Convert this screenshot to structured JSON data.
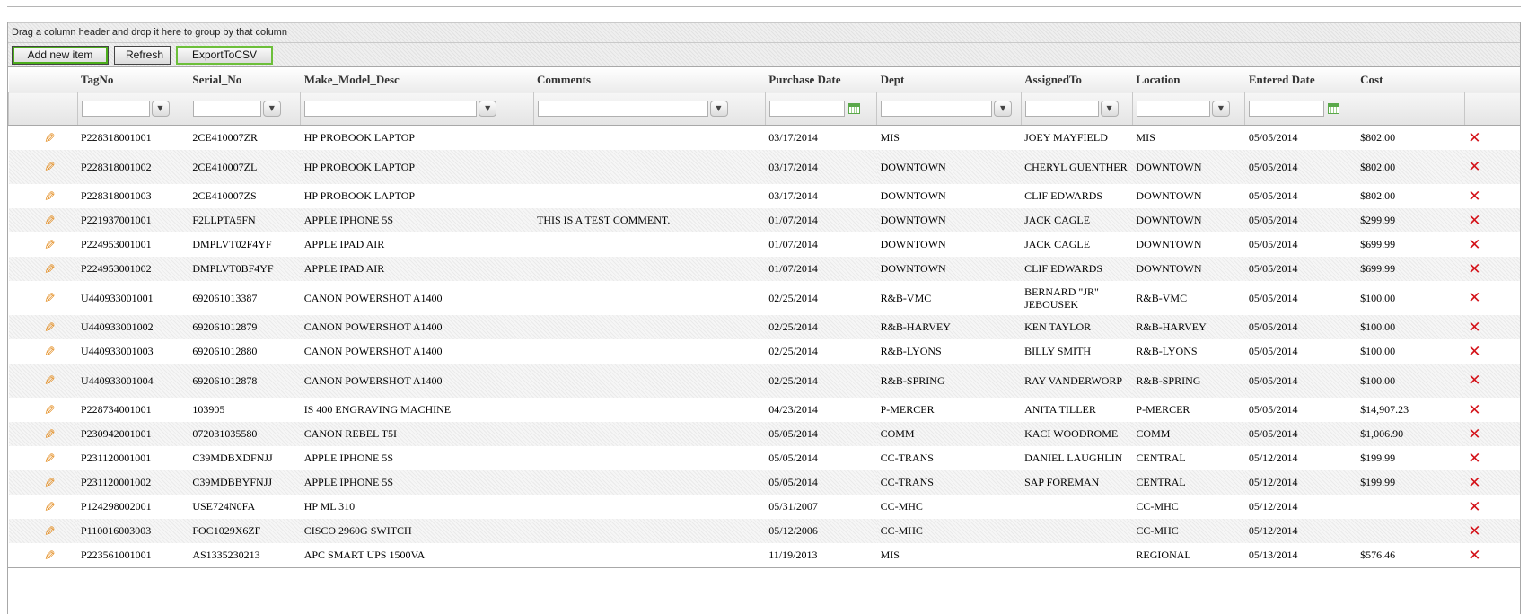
{
  "group_panel": {
    "hint": "Drag a column header and drop it here to group by that column"
  },
  "toolbar": {
    "add_label": "Add new item",
    "refresh_label": "Refresh",
    "export_label": "ExportToCSV"
  },
  "columns": [
    "TagNo",
    "Serial_No",
    "Make_Model_Desc",
    "Comments",
    "Purchase Date",
    "Dept",
    "AssignedTo",
    "Location",
    "Entered Date",
    "Cost"
  ],
  "icons": {
    "edit": "pencil-icon",
    "delete": "close-x-icon",
    "filter": "filter-funnel-icon",
    "calendar": "calendar-icon"
  },
  "colors": {
    "delete": "#d4141b",
    "edit": "#e38a1b",
    "button_outline": "#4cae1c"
  },
  "rows": [
    {
      "tag": "P228318001001",
      "serial": "2CE410007ZR",
      "model": "HP PROBOOK LAPTOP",
      "comments": "",
      "purchase": "03/17/2014",
      "dept": "MIS",
      "assigned": "JOEY MAYFIELD",
      "location": "MIS",
      "entered": "05/05/2014",
      "cost": "$802.00"
    },
    {
      "tag": "P228318001002",
      "serial": "2CE410007ZL",
      "model": "HP PROBOOK LAPTOP",
      "comments": "",
      "purchase": "03/17/2014",
      "dept": "DOWNTOWN",
      "assigned": "CHERYL GUENTHER",
      "location": "DOWNTOWN",
      "entered": "05/05/2014",
      "cost": "$802.00"
    },
    {
      "tag": "P228318001003",
      "serial": "2CE410007ZS",
      "model": "HP PROBOOK LAPTOP",
      "comments": "",
      "purchase": "03/17/2014",
      "dept": "DOWNTOWN",
      "assigned": "CLIF EDWARDS",
      "location": "DOWNTOWN",
      "entered": "05/05/2014",
      "cost": "$802.00"
    },
    {
      "tag": "P221937001001",
      "serial": "F2LLPTA5FN",
      "model": "APPLE IPHONE 5S",
      "comments": "THIS IS A TEST COMMENT.",
      "purchase": "01/07/2014",
      "dept": "DOWNTOWN",
      "assigned": "JACK CAGLE",
      "location": "DOWNTOWN",
      "entered": "05/05/2014",
      "cost": "$299.99"
    },
    {
      "tag": "P224953001001",
      "serial": "DMPLVT02F4YF",
      "model": "APPLE IPAD AIR",
      "comments": "",
      "purchase": "01/07/2014",
      "dept": "DOWNTOWN",
      "assigned": "JACK CAGLE",
      "location": "DOWNTOWN",
      "entered": "05/05/2014",
      "cost": "$699.99"
    },
    {
      "tag": "P224953001002",
      "serial": "DMPLVT0BF4YF",
      "model": "APPLE IPAD AIR",
      "comments": "",
      "purchase": "01/07/2014",
      "dept": "DOWNTOWN",
      "assigned": "CLIF EDWARDS",
      "location": "DOWNTOWN",
      "entered": "05/05/2014",
      "cost": "$699.99"
    },
    {
      "tag": "U440933001001",
      "serial": "692061013387",
      "model": "CANON POWERSHOT A1400",
      "comments": "",
      "purchase": "02/25/2014",
      "dept": "R&B-VMC",
      "assigned": "BERNARD \"JR\" JEBOUSEK",
      "location": "R&B-VMC",
      "entered": "05/05/2014",
      "cost": "$100.00"
    },
    {
      "tag": "U440933001002",
      "serial": "692061012879",
      "model": "CANON POWERSHOT A1400",
      "comments": "",
      "purchase": "02/25/2014",
      "dept": "R&B-HARVEY",
      "assigned": "KEN TAYLOR",
      "location": "R&B-HARVEY",
      "entered": "05/05/2014",
      "cost": "$100.00"
    },
    {
      "tag": "U440933001003",
      "serial": "692061012880",
      "model": "CANON POWERSHOT A1400",
      "comments": "",
      "purchase": "02/25/2014",
      "dept": "R&B-LYONS",
      "assigned": "BILLY SMITH",
      "location": "R&B-LYONS",
      "entered": "05/05/2014",
      "cost": "$100.00"
    },
    {
      "tag": "U440933001004",
      "serial": "692061012878",
      "model": "CANON POWERSHOT A1400",
      "comments": "",
      "purchase": "02/25/2014",
      "dept": "R&B-SPRING",
      "assigned": "RAY VANDERWORP",
      "location": "R&B-SPRING",
      "entered": "05/05/2014",
      "cost": "$100.00"
    },
    {
      "tag": "P228734001001",
      "serial": "103905",
      "model": "IS 400 ENGRAVING MACHINE",
      "comments": "",
      "purchase": "04/23/2014",
      "dept": "P-MERCER",
      "assigned": "ANITA TILLER",
      "location": "P-MERCER",
      "entered": "05/05/2014",
      "cost": "$14,907.23"
    },
    {
      "tag": "P230942001001",
      "serial": "072031035580",
      "model": "CANON REBEL T5I",
      "comments": "",
      "purchase": "05/05/2014",
      "dept": "COMM",
      "assigned": "KACI WOODROME",
      "location": "COMM",
      "entered": "05/05/2014",
      "cost": "$1,006.90"
    },
    {
      "tag": "P231120001001",
      "serial": "C39MDBXDFNJJ",
      "model": "APPLE IPHONE 5S",
      "comments": "",
      "purchase": "05/05/2014",
      "dept": "CC-TRANS",
      "assigned": "DANIEL LAUGHLIN",
      "location": "CENTRAL",
      "entered": "05/12/2014",
      "cost": "$199.99"
    },
    {
      "tag": "P231120001002",
      "serial": "C39MDBBYFNJJ",
      "model": "APPLE IPHONE 5S",
      "comments": "",
      "purchase": "05/05/2014",
      "dept": "CC-TRANS",
      "assigned": "SAP FOREMAN",
      "location": "CENTRAL",
      "entered": "05/12/2014",
      "cost": "$199.99"
    },
    {
      "tag": "P124298002001",
      "serial": "USE724N0FA",
      "model": "HP ML 310",
      "comments": "",
      "purchase": "05/31/2007",
      "dept": "CC-MHC",
      "assigned": "",
      "location": "CC-MHC",
      "entered": "05/12/2014",
      "cost": ""
    },
    {
      "tag": "P110016003003",
      "serial": "FOC1029X6ZF",
      "model": "CISCO 2960G SWITCH",
      "comments": "",
      "purchase": "05/12/2006",
      "dept": "CC-MHC",
      "assigned": "",
      "location": "CC-MHC",
      "entered": "05/12/2014",
      "cost": ""
    },
    {
      "tag": "P223561001001",
      "serial": "AS1335230213",
      "model": "APC SMART UPS 1500VA",
      "comments": "",
      "purchase": "11/19/2013",
      "dept": "MIS",
      "assigned": "",
      "location": "REGIONAL",
      "entered": "05/13/2014",
      "cost": "$576.46"
    }
  ]
}
